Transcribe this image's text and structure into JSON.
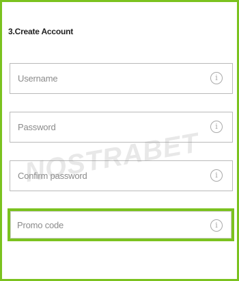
{
  "section": {
    "title": "3.Create Account"
  },
  "fields": {
    "username": {
      "placeholder": "Username",
      "icon": "info-icon"
    },
    "password": {
      "placeholder": "Password",
      "icon": "info-icon"
    },
    "confirm_password": {
      "placeholder": "Confirm password",
      "icon": "info-icon"
    },
    "promo_code": {
      "placeholder": "Promo code",
      "icon": "info-icon"
    }
  },
  "info_glyph": "i",
  "watermark": {
    "text": "NOSTRABET"
  },
  "colors": {
    "highlight": "#7bc21f",
    "border": "#b9b9b9",
    "placeholder": "#8b8b8b"
  }
}
